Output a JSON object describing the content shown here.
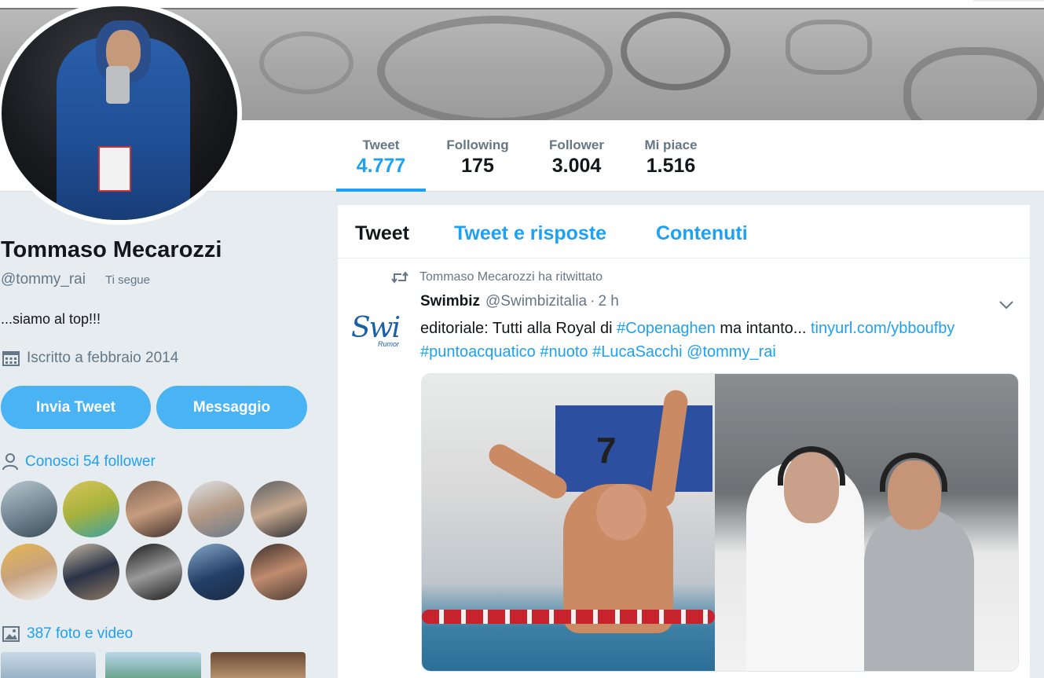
{
  "profile": {
    "name": "Tommaso Mecarozzi",
    "handle": "@tommy_rai",
    "follows_you": "Ti segue",
    "bio": "...siamo al top!!!",
    "joined": "Iscritto a febbraio 2014"
  },
  "stats": [
    {
      "label": "Tweet",
      "value": "4.777"
    },
    {
      "label": "Following",
      "value": "175"
    },
    {
      "label": "Follower",
      "value": "3.004"
    },
    {
      "label": "Mi piace",
      "value": "1.516"
    }
  ],
  "actions": {
    "tweet_label": "Invia Tweet",
    "message_label": "Messaggio"
  },
  "followers_you_know": "Conosci 54 follower",
  "media_link": "387 foto e video",
  "timeline": {
    "tabs": [
      "Tweet",
      "Tweet e risposte",
      "Contenuti"
    ],
    "retweet_notice": "Tommaso Mecarozzi ha ritwittato",
    "tweet": {
      "avatar_text": "Swi",
      "avatar_subtext": "Rumor",
      "author_name": "Swimbiz",
      "author_handle": "@Swimbizitalia",
      "separator": "·",
      "time": "2 h",
      "text_1": "editoriale: Tutti alla Royal di ",
      "link_1": "#Copenaghen",
      "text_2": " ma intanto... ",
      "link_2": "tinyurl.com/ybboufby",
      "tags": "#puntoacquatico #nuoto #LucaSacchi @tommy_rai",
      "photo_number": "7"
    }
  },
  "colors": {
    "accent": "#1da1f2",
    "button": "#4ab3f4",
    "muted": "#657786",
    "background": "#e6ecf0"
  }
}
